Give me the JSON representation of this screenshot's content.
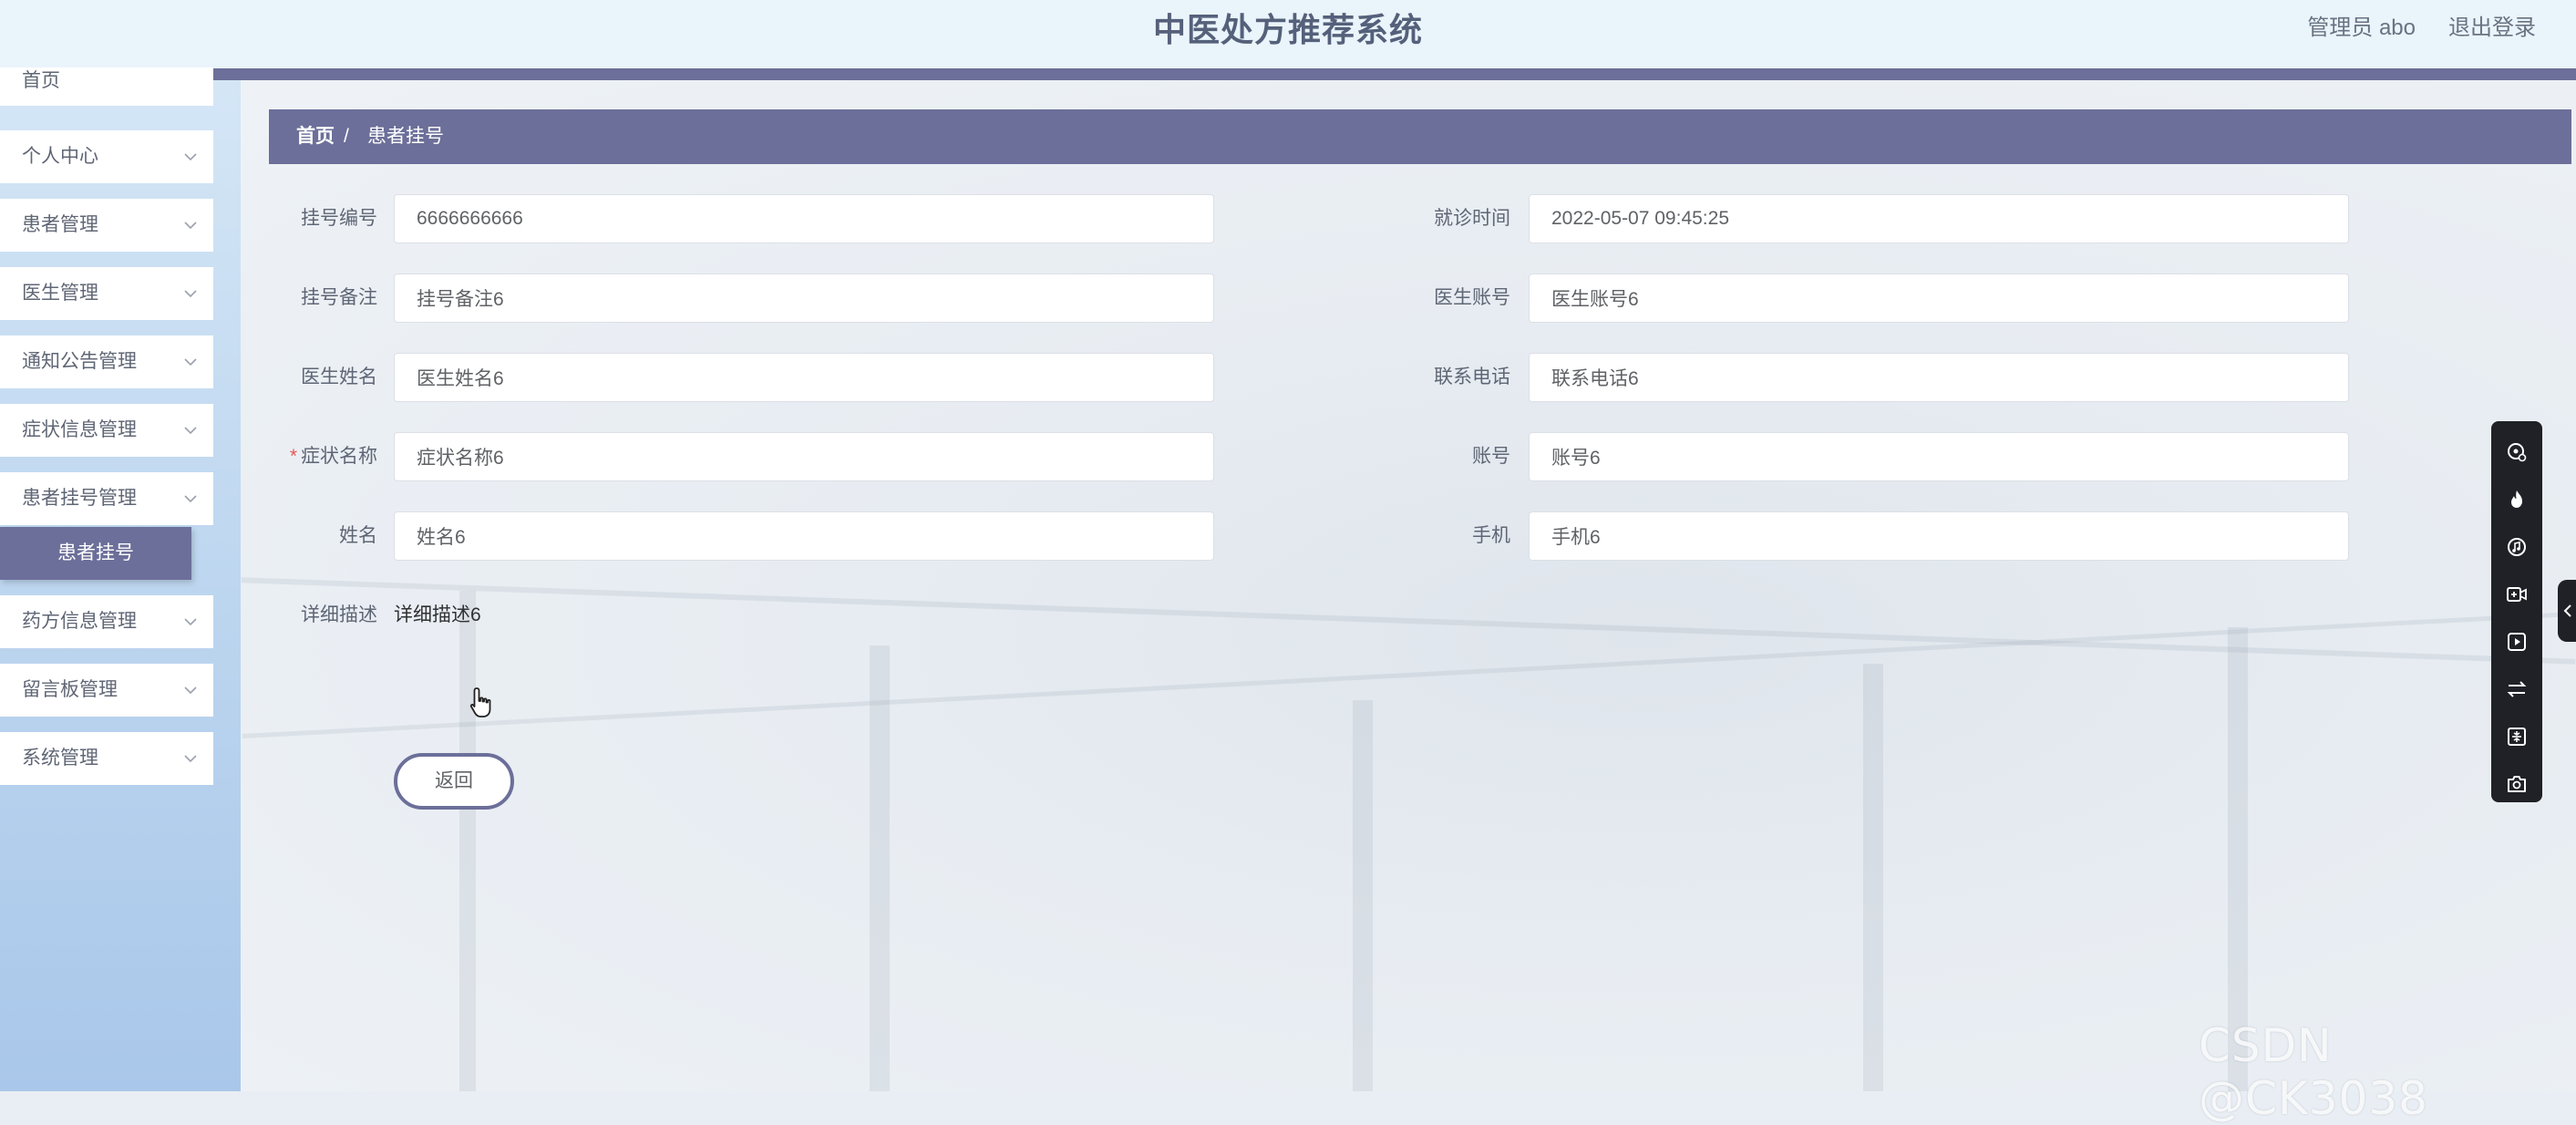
{
  "header": {
    "title": "中医处方推荐系统",
    "user_label": "管理员 abo",
    "logout_label": "退出登录"
  },
  "sidebar": {
    "items": [
      {
        "label": "首页"
      },
      {
        "label": "个人中心"
      },
      {
        "label": "患者管理"
      },
      {
        "label": "医生管理"
      },
      {
        "label": "通知公告管理"
      },
      {
        "label": "症状信息管理"
      },
      {
        "label": "患者挂号管理"
      },
      {
        "label": "药方信息管理"
      },
      {
        "label": "留言板管理"
      },
      {
        "label": "系统管理"
      }
    ],
    "active_sub": "患者挂号"
  },
  "breadcrumb": {
    "home": "首页",
    "separator": "/",
    "current": "患者挂号"
  },
  "form": {
    "reg_no": {
      "label": "挂号编号",
      "value": "6666666666"
    },
    "visit_time": {
      "label": "就诊时间",
      "value": "2022-05-07 09:45:25"
    },
    "reg_note": {
      "label": "挂号备注",
      "value": "挂号备注6"
    },
    "doctor_account": {
      "label": "医生账号",
      "value": "医生账号6"
    },
    "doctor_name": {
      "label": "医生姓名",
      "value": "医生姓名6"
    },
    "phone": {
      "label": "联系电话",
      "value": "联系电话6"
    },
    "symptom": {
      "label": "症状名称",
      "value": "症状名称6",
      "required_mark": "*"
    },
    "account": {
      "label": "账号",
      "value": "账号6"
    },
    "name": {
      "label": "姓名",
      "value": "姓名6"
    },
    "mobile": {
      "label": "手机",
      "value": "手机6"
    },
    "description": {
      "label": "详细描述",
      "value": "详细描述6"
    }
  },
  "actions": {
    "back_label": "返回"
  },
  "toolbar_icons": [
    "screen-record-icon",
    "fire-icon",
    "music-icon",
    "video-add-icon",
    "video-play-icon",
    "swap-icon",
    "compress-icon",
    "camera-icon"
  ],
  "watermark": "CSDN @CK3038",
  "colors": {
    "accent": "#6c6f99",
    "header_bg": "#eaf4fb",
    "title": "#55607a"
  }
}
